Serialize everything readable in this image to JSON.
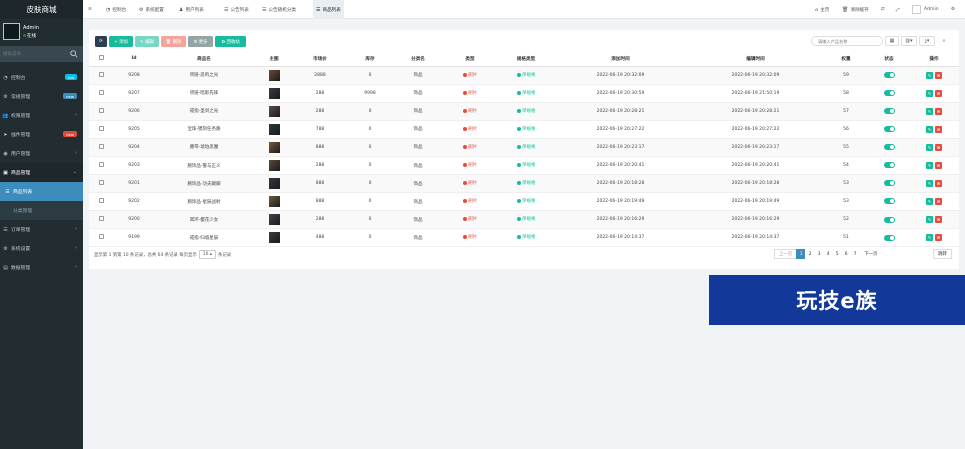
{
  "app": {
    "brand": "皮肤商城",
    "user": "Admin",
    "status": "在线",
    "search_placeholder": "搜索菜单..."
  },
  "menu": [
    {
      "label": "控制台",
      "icon": "dashboard-icon",
      "badge": "hot",
      "badge_color": "#00c0ef"
    },
    {
      "label": "常规管理",
      "icon": "cogs-icon",
      "badge": "new",
      "badge_color": "#3c8dbc"
    },
    {
      "label": "权限管理",
      "icon": "users-icon",
      "arrow": "‹"
    },
    {
      "label": "插件管理",
      "icon": "rocket-icon",
      "badge": "new",
      "badge_color": "#dd4b39"
    },
    {
      "label": "用户管理",
      "icon": "user-circle-icon",
      "arrow": "‹"
    },
    {
      "label": "商品管理",
      "icon": "cube-icon",
      "arrow": "⌄"
    }
  ],
  "submenu": [
    {
      "label": "商品列表"
    },
    {
      "label": "分类管理"
    }
  ],
  "menu_after": [
    {
      "label": "订单管理",
      "icon": "list-icon",
      "arrow": "‹"
    },
    {
      "label": "系统设置",
      "icon": "gear-icon",
      "arrow": "‹"
    },
    {
      "label": "数据管理",
      "icon": "database-icon",
      "arrow": "‹"
    }
  ],
  "tabs": [
    {
      "label": "控制台",
      "icon": "dashboard-icon"
    },
    {
      "label": "系统配置",
      "icon": "cog-icon"
    },
    {
      "label": "用户列表",
      "icon": "user-icon"
    },
    {
      "label": "公告列表",
      "icon": "list-icon"
    },
    {
      "label": "公告随机分类",
      "icon": "list-icon"
    },
    {
      "label": "商品列表",
      "icon": "list-icon",
      "active": true
    }
  ],
  "top_right": {
    "home": "主页",
    "clear": "清除缓存",
    "admin": "Admin"
  },
  "toolbar": {
    "refresh": "⟳",
    "add": "+ 添加",
    "edit": "✎ 编辑",
    "delete": "🗑 删除",
    "more": "⚙ 更多",
    "recycle": "♻ 回收站",
    "search_placeholder": "请输入产品名称"
  },
  "columns": [
    "",
    "Id",
    "商品名",
    "主图",
    "市场价",
    "库存",
    "分类名",
    "类型",
    "规格类型",
    "添加时间",
    "编辑时间",
    "权重",
    "状态",
    "操作"
  ],
  "rows": [
    {
      "id": "9208",
      "name": "项链-悲鸣之光",
      "price": "2888",
      "stock": "0",
      "cat": "饰品",
      "type": "刷片",
      "spec": "单规格",
      "add": "2022-06-19 20:32:09",
      "edit": "2022-06-19 20:32:09",
      "weight": "59"
    },
    {
      "id": "9207",
      "name": "项链-暗影先锋",
      "price": "288",
      "stock": "9998",
      "cat": "饰品",
      "type": "刷片",
      "spec": "单规格",
      "add": "2022-06-19 20:30:59",
      "edit": "2022-06-19 21:50:19",
      "weight": "58"
    },
    {
      "id": "9206",
      "name": "戒指-圣剑之光",
      "price": "288",
      "stock": "0",
      "cat": "饰品",
      "type": "刷片",
      "spec": "单规格",
      "add": "2022-06-19 20:28:21",
      "edit": "2022-06-19 20:28:21",
      "weight": "57"
    },
    {
      "id": "9205",
      "name": "宝珠-镌刻任务路",
      "price": "788",
      "stock": "0",
      "cat": "饰品",
      "type": "刷片",
      "spec": "单规格",
      "add": "2022-06-19 20:27:22",
      "edit": "2022-06-19 20:27:22",
      "weight": "56"
    },
    {
      "id": "9204",
      "name": "腰带-琥珀恶魔",
      "price": "888",
      "stock": "0",
      "cat": "饰品",
      "type": "刷片",
      "spec": "单规格",
      "add": "2022-06-19 20:23:17",
      "edit": "2022-06-19 20:23:17",
      "weight": "55"
    },
    {
      "id": "9203",
      "name": "腕饰品-警与正义",
      "price": "288",
      "stock": "0",
      "cat": "饰品",
      "type": "刷片",
      "spec": "单规格",
      "add": "2022-06-19 20:20:41",
      "edit": "2022-06-19 20:20:41",
      "weight": "54"
    },
    {
      "id": "9201",
      "name": "腕饰品-功夫踢脚",
      "price": "888",
      "stock": "0",
      "cat": "饰品",
      "type": "刷片",
      "spec": "单规格",
      "add": "2022-06-19 20:18:28",
      "edit": "2022-06-19 20:18:28",
      "weight": "53"
    },
    {
      "id": "9202",
      "name": "腕饰品-星辰战射",
      "price": "888",
      "stock": "0",
      "cat": "饰品",
      "type": "刷片",
      "spec": "单规格",
      "add": "2022-06-19 20:19:49",
      "edit": "2022-06-19 20:19:49",
      "weight": "53"
    },
    {
      "id": "9200",
      "name": "耳环-樱花少女",
      "price": "288",
      "stock": "0",
      "cat": "饰品",
      "type": "刷片",
      "spec": "单规格",
      "add": "2022-06-19 20:16:29",
      "edit": "2022-06-19 20:16:29",
      "weight": "52"
    },
    {
      "id": "9199",
      "name": "戒指-归墟星辰",
      "price": "488",
      "stock": "0",
      "cat": "饰品",
      "type": "刷片",
      "spec": "单规格",
      "add": "2022-06-19 20:14:37",
      "edit": "2022-06-19 20:14:37",
      "weight": "51"
    }
  ],
  "footer": {
    "info_pre": "显示第 1 到第 10 条记录，总共 64 条记录 每页显示",
    "per_page": "10 ▴",
    "info_post": "条记录"
  },
  "pagination": {
    "prev": "上一页",
    "pages": [
      "1",
      "2",
      "3",
      "4",
      "5",
      "6",
      "7"
    ],
    "next": "下一页",
    "goto": "跳转"
  },
  "watermark": "玩技e族",
  "colors": {
    "sidebar": "#222d32",
    "accent": "#3c8dbc",
    "green": "#18bc9c",
    "red": "#e74c3c"
  }
}
